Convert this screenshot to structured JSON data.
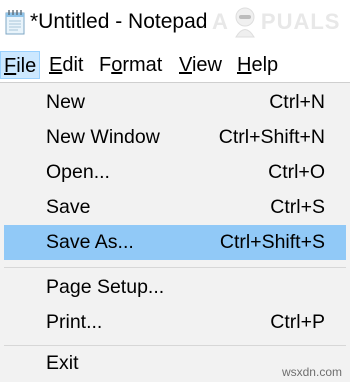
{
  "window": {
    "title": "*Untitled - Notepad",
    "app_icon": "notepad-icon"
  },
  "watermark": {
    "left": "A",
    "right": "PUALS"
  },
  "menubar": {
    "items": [
      {
        "mnemonic": "F",
        "rest": "ile",
        "active": true
      },
      {
        "mnemonic": "E",
        "rest": "dit"
      },
      {
        "mnemonic": "o",
        "pre": "F",
        "rest": "rmat"
      },
      {
        "mnemonic": "V",
        "rest": "iew"
      },
      {
        "mnemonic": "H",
        "rest": "elp"
      }
    ]
  },
  "file_menu": {
    "items": [
      {
        "label": "New",
        "shortcut": "Ctrl+N"
      },
      {
        "label": "New Window",
        "shortcut": "Ctrl+Shift+N"
      },
      {
        "label": "Open...",
        "shortcut": "Ctrl+O"
      },
      {
        "label": "Save",
        "shortcut": "Ctrl+S"
      },
      {
        "label": "Save As...",
        "shortcut": "Ctrl+Shift+S",
        "highlighted": true
      },
      {
        "label": "Page Setup...",
        "shortcut": ""
      },
      {
        "label": "Print...",
        "shortcut": "Ctrl+P"
      },
      {
        "label": "Exit",
        "shortcut": ""
      }
    ]
  },
  "footer": {
    "site": "wsxdn.com"
  },
  "colors": {
    "menu_background": "#f2f2f2",
    "highlight": "#91c9f7",
    "menubar_active": "#cce8ff"
  }
}
